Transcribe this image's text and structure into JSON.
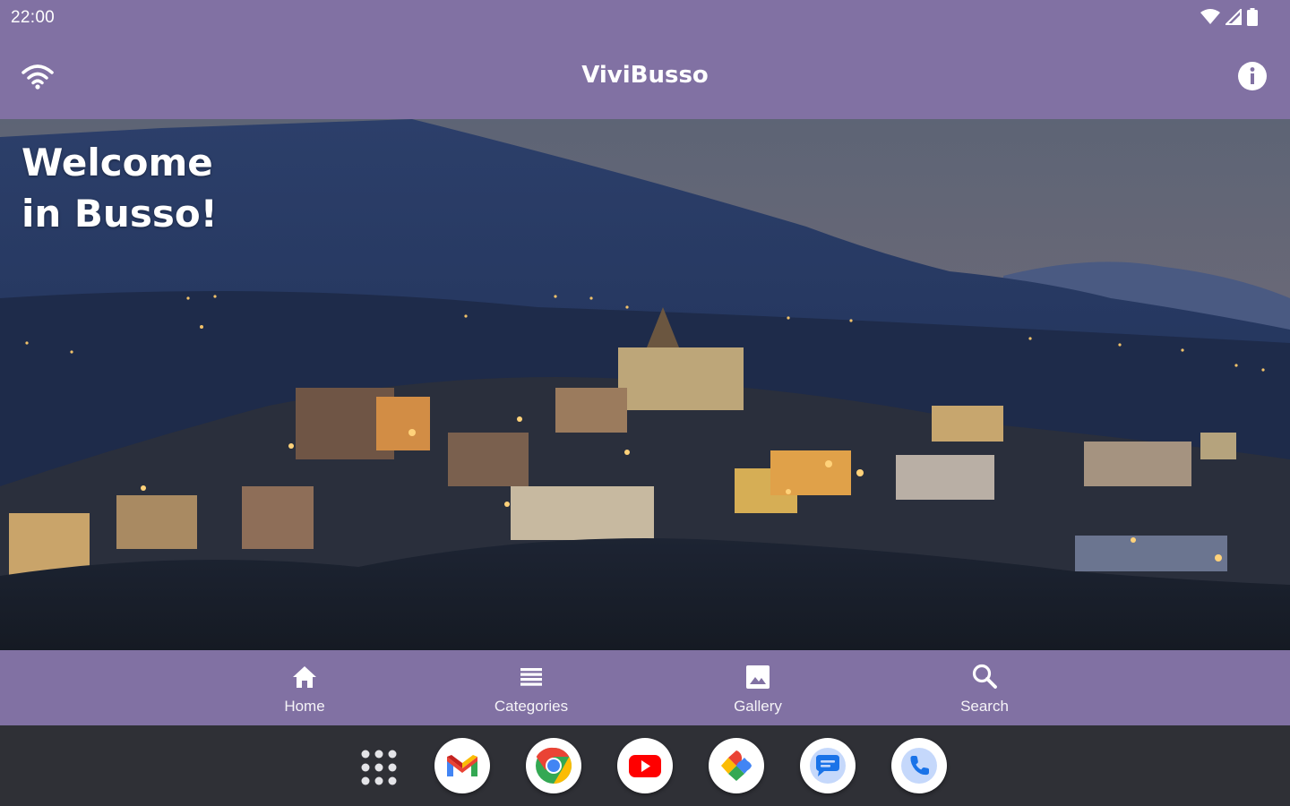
{
  "status_bar": {
    "time": "22:00",
    "icons": [
      "wifi-signal-icon",
      "cell-signal-icon",
      "battery-icon"
    ]
  },
  "app_bar": {
    "title": "ViviBusso",
    "left_icon": "wifi-icon",
    "right_icon": "info-icon"
  },
  "hero": {
    "welcome_line1": "Welcome",
    "welcome_line2": "in Busso!"
  },
  "bottom_nav": {
    "items": [
      {
        "label": "Home",
        "icon": "home-icon"
      },
      {
        "label": "Categories",
        "icon": "list-icon"
      },
      {
        "label": "Gallery",
        "icon": "image-icon"
      },
      {
        "label": "Search",
        "icon": "search-icon"
      }
    ]
  },
  "taskbar": {
    "apps": [
      "app-drawer-icon",
      "gmail-icon",
      "chrome-icon",
      "youtube-icon",
      "photos-icon",
      "messages-icon",
      "phone-icon"
    ]
  },
  "colors": {
    "app_bar": "#8171a3",
    "taskbar": "#2f3036",
    "text": "#ffffff"
  }
}
